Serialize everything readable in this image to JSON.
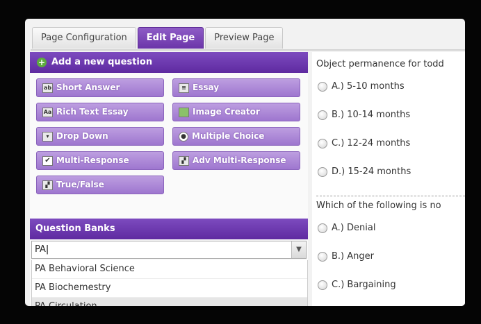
{
  "tabs": {
    "page_configuration": "Page Configuration",
    "edit_page": "Edit Page",
    "preview_page": "Preview Page"
  },
  "add_question": {
    "header": "Add a new question",
    "buttons": {
      "short_answer": "Short Answer",
      "essay": "Essay",
      "rich_text_essay": "Rich Text Essay",
      "image_creator": "Image Creator",
      "drop_down": "Drop Down",
      "multiple_choice": "Multiple Choice",
      "multi_response": "Multi-Response",
      "adv_multi_response": "Adv Multi-Response",
      "true_false": "True/False"
    }
  },
  "question_banks": {
    "header": "Question Banks",
    "input_value": "PA",
    "suggestions": [
      "PA Behavioral Science",
      "PA Biochemestry",
      "PA Circulation"
    ]
  },
  "preview": {
    "q1": {
      "title": "Object permanence for todd",
      "options": [
        "A.) 5-10 months",
        "B.) 10-14 months",
        "C.) 12-24 months",
        "D.) 15-24 months"
      ]
    },
    "q2": {
      "title": "Which of the following is no",
      "options": [
        "A.) Denial",
        "B.) Anger",
        "C.) Bargaining"
      ]
    }
  },
  "colors": {
    "accent": "#6b35a9",
    "button": "#a27ad2"
  }
}
